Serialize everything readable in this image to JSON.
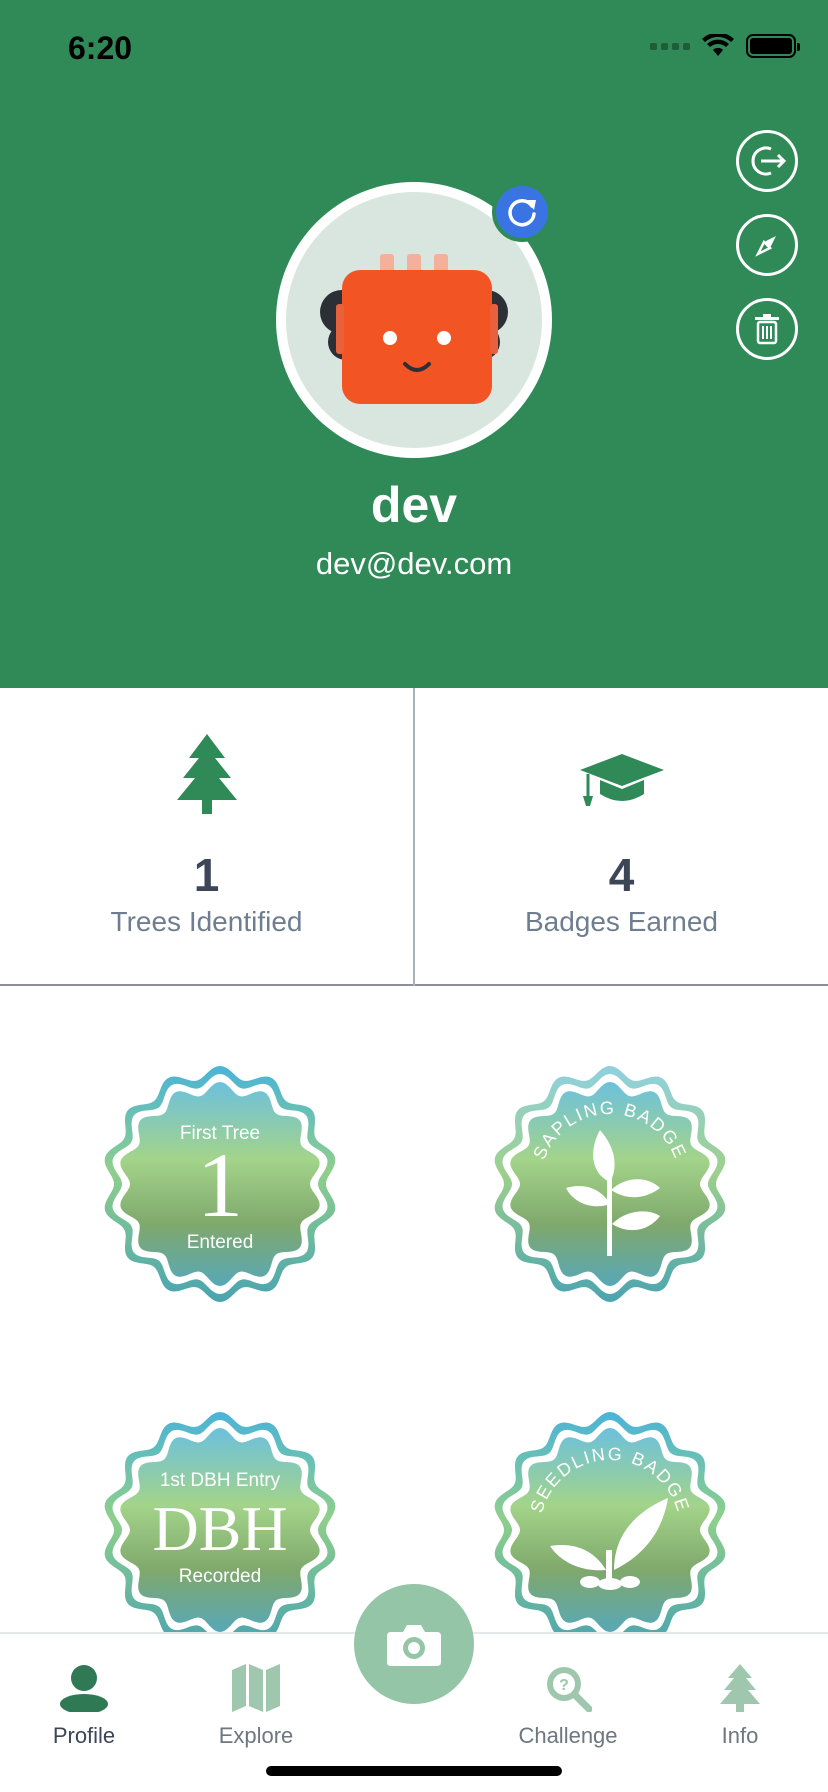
{
  "status_bar": {
    "time": "6:20"
  },
  "profile": {
    "username": "dev",
    "email": "dev@dev.com"
  },
  "stats": {
    "trees": {
      "value": "1",
      "label": "Trees Identified"
    },
    "badges": {
      "value": "4",
      "label": "Badges Earned"
    }
  },
  "badges": [
    {
      "top": "First Tree",
      "main": "1",
      "bottom": "Entered"
    },
    {
      "arc": "SAPLING BADGE"
    },
    {
      "top": "1st DBH Entry",
      "main": "DBH",
      "bottom": "Recorded"
    },
    {
      "arc": "SEEDLING BADGE"
    }
  ],
  "tabs": {
    "profile": "Profile",
    "explore": "Explore",
    "challenge": "Challenge",
    "info": "Info"
  },
  "colors": {
    "header_bg": "#2f8a58",
    "accent_green": "#2f8a58",
    "refresh_blue": "#3a74e3",
    "camera_button": "#95c5a7"
  }
}
